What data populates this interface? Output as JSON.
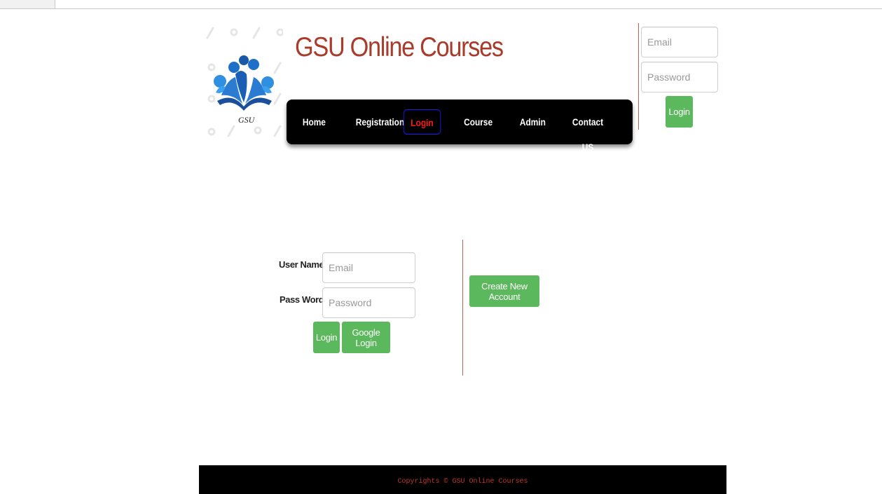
{
  "header": {
    "logo_text": "GSU",
    "site_title": "GSU Online Courses"
  },
  "nav": {
    "items": [
      {
        "label": "Home"
      },
      {
        "label": "Registration"
      },
      {
        "label": "Login",
        "active": true
      },
      {
        "label": "Course"
      },
      {
        "label": "Admin"
      },
      {
        "label": "Contact US"
      }
    ]
  },
  "top_login": {
    "email_placeholder": "Email",
    "password_placeholder": "Password",
    "login_label": "Login"
  },
  "main_login": {
    "username_label": "User Name",
    "username_placeholder": "Email",
    "password_label": "Pass Word",
    "password_placeholder": "Password",
    "login_label": "Login",
    "google_login_label": "Google Login",
    "create_account_label": "Create New Account"
  },
  "footer": {
    "text": "Copyrights © GSU Online Courses"
  },
  "colors": {
    "title": "#a93b2a",
    "nav_bg": "#000000",
    "nav_active_text": "#ff1a1a",
    "nav_active_border": "#1a1aff",
    "button_green": "#5cb85c",
    "divider": "#c0614a",
    "footer_text": "#c0392b"
  }
}
